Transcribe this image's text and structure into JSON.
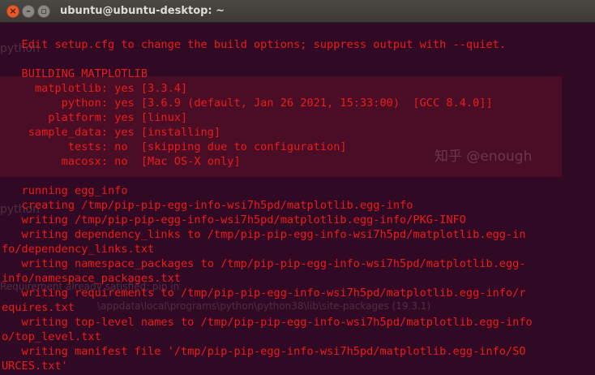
{
  "window": {
    "title": "ubuntu@ubuntu-desktop: ~",
    "close_glyph": "×",
    "minimize_glyph": "–",
    "maximize_glyph": "▫"
  },
  "terminal": {
    "text_color": "#ee1a1a",
    "background": "#300a24",
    "lines": [
      "   Edit setup.cfg to change the build options; suppress output with --quiet.",
      "",
      "   BUILDING MATPLOTLIB",
      "     matplotlib: yes [3.3.4]",
      "         python: yes [3.6.9 (default, Jan 26 2021, 15:33:00)  [GCC 8.4.0]]",
      "       platform: yes [linux]",
      "    sample_data: yes [installing]",
      "          tests: no  [skipping due to configuration]",
      "         macosx: no  [Mac OS-X only]",
      "",
      "   running egg_info",
      "   creating /tmp/pip-pip-egg-info-wsi7h5pd/matplotlib.egg-info",
      "   writing /tmp/pip-pip-egg-info-wsi7h5pd/matplotlib.egg-info/PKG-INFO",
      "   writing dependency_links to /tmp/pip-pip-egg-info-wsi7h5pd/matplotlib.egg-in",
      "fo/dependency_links.txt",
      "   writing namespace_packages to /tmp/pip-pip-egg-info-wsi7h5pd/matplotlib.egg-",
      "info/namespace_packages.txt",
      "   writing requirements to /tmp/pip-pip-egg-info-wsi7h5pd/matplotlib.egg-info/r",
      "equires.txt",
      "   writing top-level names to /tmp/pip-pip-egg-info-wsi7h5pd/matplotlib.egg-info",
      "o/top_level.txt",
      "   writing manifest file '/tmp/pip-pip-egg-info-wsi7h5pd/matplotlib.egg-info/SO",
      "URCES.txt'"
    ]
  },
  "background_ghost": {
    "top_left": "python",
    "middle_left": "python",
    "watermark": "知乎 @enough",
    "path_text": "\\appdata\\local\\programs\\python\\python38\\lib\\site-packages (19.3.1)",
    "requirement_text": "Requirement already satisfied: pip in"
  }
}
